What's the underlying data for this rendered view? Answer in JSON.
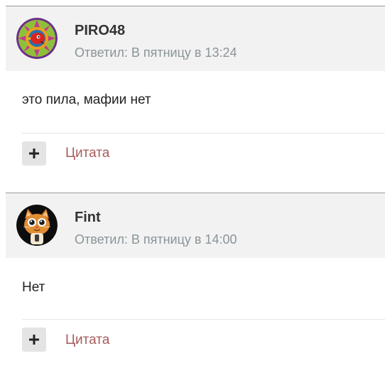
{
  "posts": [
    {
      "author": "PIRO48",
      "meta": "Ответил: В пятницу в 13:24",
      "body": "это пила, мафии нет",
      "quote_label": "Цитата",
      "avatar_icon": "mandala-bird-avatar"
    },
    {
      "author": "Fint",
      "meta": "Ответил: В пятницу в 14:00",
      "body": "Нет",
      "quote_label": "Цитата",
      "avatar_icon": "cat-avatar"
    }
  ],
  "colors": {
    "header_bg": "#f2f2f2",
    "author": "#333333",
    "meta": "#8a9499",
    "quote_link": "#a65b5b",
    "button_bg": "#e4e4e4"
  }
}
